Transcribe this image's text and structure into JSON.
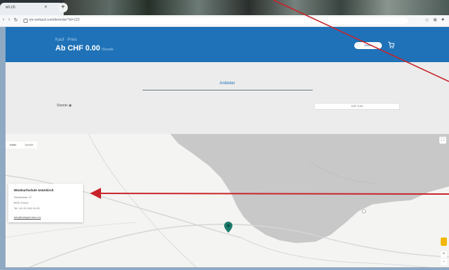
{
  "browser": {
    "tab_title": "wt.ch",
    "tab_close": "×",
    "new_tab": "+",
    "nav_back": "‹",
    "nav_forward": "›",
    "nav_reload": "↻",
    "url": "ws-verkauf.com/de/order?id=123"
  },
  "header": {
    "small_text": "Kauf · Preis",
    "price": "Ab CHF 0.00",
    "price_unit": "/Stunde",
    "button_label": "Weiter",
    "brand_color": "#1f72b8"
  },
  "section": {
    "title": "Anbieter",
    "row_label": "Stunde ◉",
    "select_value": "CHF 0.00"
  },
  "map": {
    "tab_map": "Karte",
    "tab_satellite": "Satellit",
    "info": {
      "title": "Windsurfschule Unterkirch",
      "line1": "Seestrasse 12",
      "line2": "8000 Zürich",
      "line3": "Tel +41 00 000 00 00",
      "link": "info@beispiel-wind.ch"
    },
    "zoom_in": "+",
    "zoom_out": "−",
    "marker_color": "#1b7a6b",
    "lake_color": "#c8c8c8"
  },
  "annotation": {
    "arrow_color": "#c8232a"
  }
}
